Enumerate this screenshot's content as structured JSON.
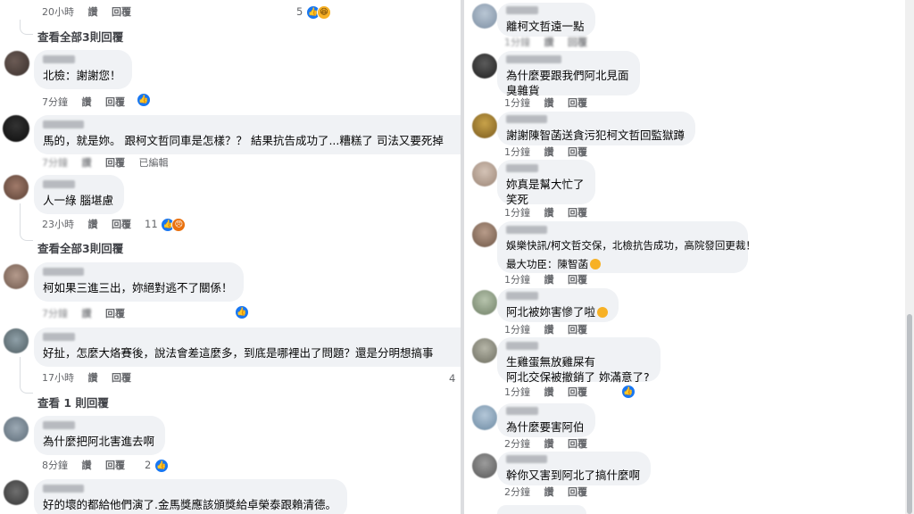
{
  "left": {
    "top_actions": {
      "time": "20小時",
      "like": "讚",
      "reply": "回覆",
      "reactions": "5"
    },
    "view_replies_1": "查看全部3則回覆",
    "comments": [
      {
        "text": [
          "北檢：謝謝您！"
        ],
        "time": "7分鐘",
        "like": "讚",
        "reply": "回覆"
      },
      {
        "text": [
          "馬的，就是妳。 跟柯文哲同車是怎樣？？ 結果抗告成功了...糟糕了 司法又要死掉"
        ],
        "time": "7分鐘",
        "like": "讚",
        "reply": "回覆",
        "edited": "已編輯"
      },
      {
        "text": [
          "人一綠 腦堪慮"
        ],
        "time": "23小時",
        "like": "讚",
        "reply": "回覆",
        "reactions": "11"
      },
      {
        "text": [
          "柯如果三進三出，妳絕對逃不了關係！"
        ],
        "time": "7分鐘",
        "like": "讚",
        "reply": "回覆"
      },
      {
        "text": [
          "好扯，怎麼大烙賽後，說法會差這麼多，到底是哪裡出了問題？還是分明想搞事"
        ],
        "time": "17小時",
        "like": "讚",
        "reply": "回覆",
        "reactions": "4"
      },
      {
        "text": [
          "為什麼把阿北害進去啊"
        ],
        "time": "8分鐘",
        "like": "讚",
        "reply": "回覆",
        "reactions": "2"
      },
      {
        "text": [
          "好的壞的都給他們演了.金馬獎應該頒獎給卓榮泰跟賴清德。"
        ]
      }
    ],
    "view_replies_2": "查看全部3則回覆",
    "view_replies_3": "查看 1 則回覆"
  },
  "right": {
    "comments": [
      {
        "text": [
          "離柯文哲遠一點"
        ],
        "time": "1分鐘",
        "like": "讚",
        "reply": "回覆"
      },
      {
        "text": [
          "為什麼要跟我們阿北見面",
          "臭雜貨"
        ],
        "time": "1分鐘",
        "like": "讚",
        "reply": "回覆"
      },
      {
        "text": [
          "謝謝陳智菡送貪污犯柯文哲回監獄蹲"
        ],
        "time": "1分鐘",
        "like": "讚",
        "reply": "回覆"
      },
      {
        "text": [
          "妳真是幫大忙了",
          "笑死"
        ],
        "time": "1分鐘",
        "like": "讚",
        "reply": "回覆"
      },
      {
        "text": [
          "娛樂快訊/柯文哲交保，北檢抗告成功，高院發回更裁！",
          "最大功臣：陳智菡"
        ],
        "time": "1分鐘",
        "like": "讚",
        "reply": "回覆"
      },
      {
        "text": [
          "阿北被妳害慘了啦"
        ],
        "time": "1分鐘",
        "like": "讚",
        "reply": "回覆"
      },
      {
        "text": [
          "生雞蛋無放雞屎有",
          "阿北交保被撤銷了 妳滿意了?"
        ],
        "time": "1分鐘",
        "like": "讚",
        "reply": "回覆"
      },
      {
        "text": [
          "為什麼要害阿伯"
        ],
        "time": "2分鐘",
        "like": "讚",
        "reply": "回覆"
      },
      {
        "text": [
          "幹你又害到阿北了搞什麼啊"
        ],
        "time": "2分鐘",
        "like": "讚",
        "reply": "回覆"
      }
    ]
  },
  "icons": {
    "like": "like-icon",
    "haha": "haha-icon",
    "angry": "angry-icon",
    "laugh_emoji": "laugh-emoji-icon"
  },
  "colors": {
    "bubble": "#f0f2f5",
    "like_blue": "#1877f2",
    "meta_text": "#65676b"
  }
}
